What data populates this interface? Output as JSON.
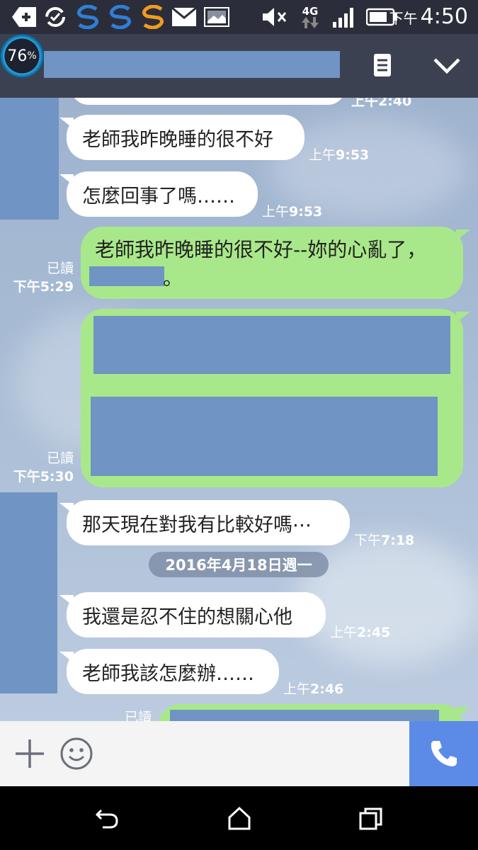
{
  "status_bar": {
    "ampm": "下午",
    "time": "4:50",
    "network": "4G",
    "icons": [
      "add-icon",
      "sync-icon",
      "s-app-icon",
      "s-app-icon",
      "s-app-icon-orange",
      "mail-icon",
      "image-icon",
      "mute-icon",
      "signal-icon",
      "battery-icon"
    ]
  },
  "header": {
    "battery_percent": "76",
    "battery_suffix": "%",
    "icons": [
      "note-icon",
      "chevron-down-icon"
    ]
  },
  "messages": {
    "m0_time": "上午2:40",
    "m1_text": "老師我昨晚睡的很不好",
    "m1_time_ap": "上午",
    "m1_time": "9:53",
    "m2_text": "怎麼回事了嗎……",
    "m2_time_ap": "上午",
    "m2_time": "9:53",
    "m3_text": "老師我昨晚睡的很不好--妳的心亂了，",
    "m3_text2": "。",
    "m3_read": "已讀",
    "m3_time": "下午5:29",
    "m4_read": "已讀",
    "m4_time": "下午5:30",
    "m5_text": "那天現在對我有比較好嗎⋯",
    "m5_time_ap": "下午",
    "m5_time": "7:18",
    "date_divider": "2016年4月18日週一",
    "m6_text": "我還是忍不住的想關心他",
    "m6_time_ap": "上午",
    "m6_time": "2:45",
    "m7_text": "老師我該怎麼辦……",
    "m7_time_ap": "上午",
    "m7_time": "2:46",
    "m8_read": "已讀"
  },
  "colors": {
    "header_bg": "#3c4152",
    "outgoing_bubble": "#a9e88a",
    "incoming_bubble": "#ffffff",
    "call_button": "#5b8be6",
    "redaction": "#7094c4"
  }
}
